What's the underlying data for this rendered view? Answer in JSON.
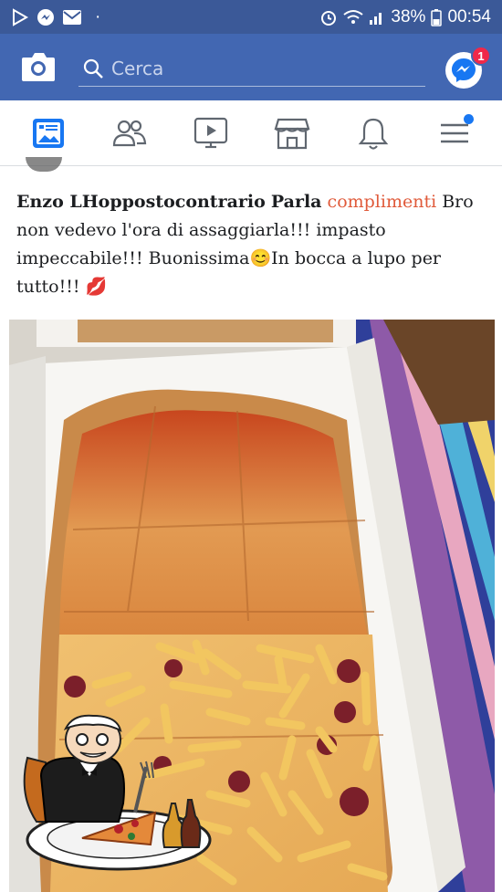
{
  "status_bar": {
    "battery": "38%",
    "time": "00:54",
    "dot": "·"
  },
  "header": {
    "search_placeholder": "Cerca",
    "messenger_badge": "1"
  },
  "tabs": [
    {
      "name": "news-feed-tab",
      "icon": "news-feed-icon",
      "active": true
    },
    {
      "name": "friends-tab",
      "icon": "friends-icon"
    },
    {
      "name": "watch-tab",
      "icon": "video-play-icon"
    },
    {
      "name": "marketplace-tab",
      "icon": "shop-icon"
    },
    {
      "name": "notifications-tab",
      "icon": "bell-icon"
    },
    {
      "name": "menu-tab",
      "icon": "hamburger-menu-icon",
      "dot": true
    }
  ],
  "post": {
    "author": "Enzo LHoppostocontrario",
    "verb": "Parla",
    "highlight": "complimenti",
    "body": "Bro non vedevo l'ora di assaggiarla!!! impasto impeccabile!!! Buonissima",
    "emoji_1": "😊",
    "body_2": "In bocca a lupo per tutto!!!",
    "emoji_2": "💋"
  },
  "colors": {
    "facebook_blue": "#4267b2",
    "status_blue": "#3b5998",
    "accent_blue": "#1877f2",
    "badge_red": "#f02849",
    "highlight": "#e05a3a"
  }
}
